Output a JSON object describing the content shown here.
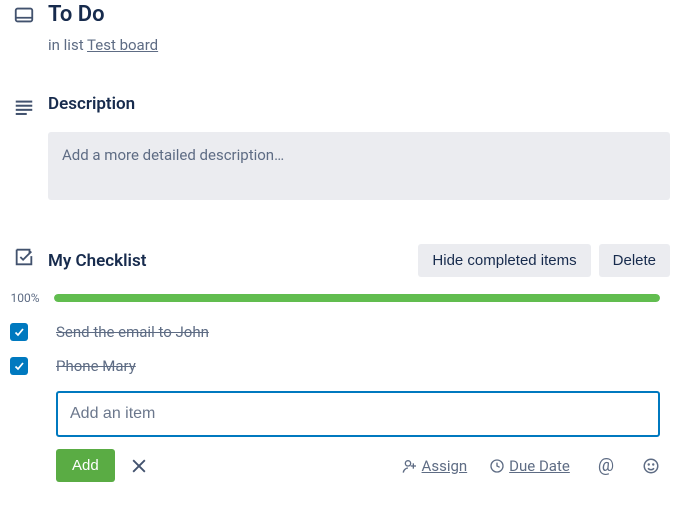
{
  "card": {
    "title": "To Do",
    "in_list_prefix": "in list ",
    "list_name": "Test board"
  },
  "description": {
    "heading": "Description",
    "placeholder": "Add a more detailed description…"
  },
  "checklist": {
    "title": "My Checklist",
    "hide_completed_label": "Hide completed items",
    "delete_label": "Delete",
    "progress_percent_label": "100%",
    "progress_value": 100,
    "items": [
      {
        "text": "Send the email to John",
        "checked": true
      },
      {
        "text": "Phone Mary",
        "checked": true
      }
    ],
    "add_item_placeholder": "Add an item",
    "add_button_label": "Add",
    "assign_label": "Assign",
    "due_date_label": "Due Date"
  },
  "colors": {
    "accent": "#0079bf",
    "green_button": "#5aac44",
    "progress_fill": "#61bd4f"
  }
}
